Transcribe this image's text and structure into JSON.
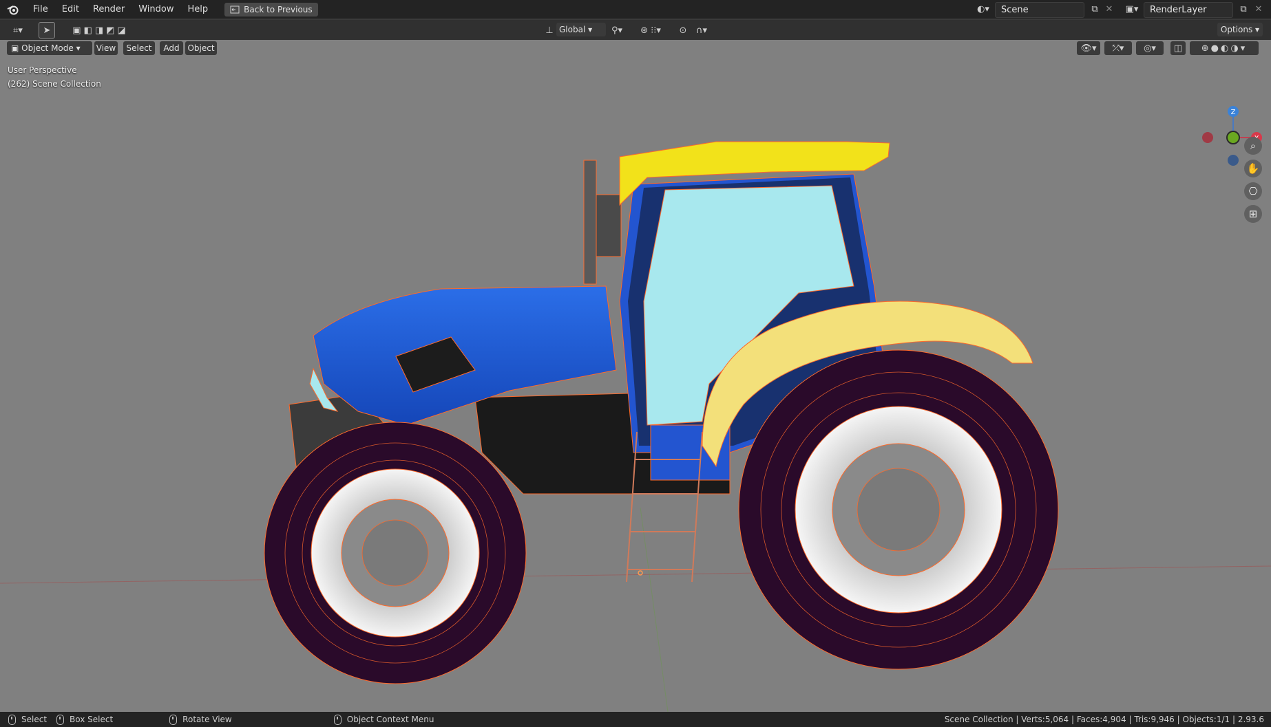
{
  "menu": [
    "File",
    "Edit",
    "Render",
    "Window",
    "Help"
  ],
  "back_button": "Back to Previous",
  "scene": "Scene",
  "render_layer": "RenderLayer",
  "toolbar": {
    "orientation": "Global",
    "options": "Options"
  },
  "viewport_header": {
    "mode": "Object Mode",
    "view": "View",
    "select": "Select",
    "add": "Add",
    "object": "Object"
  },
  "overlay": {
    "perspective": "User Perspective",
    "collection": "(262) Scene Collection"
  },
  "gizmo": {
    "z": "Z",
    "x": "X"
  },
  "status": {
    "select": "Select",
    "box_select": "Box Select",
    "rotate": "Rotate View",
    "context": "Object Context Menu",
    "stats": "Scene Collection | Verts:5,064 | Faces:4,904 | Tris:9,946 | Objects:1/1 | 2.93.6"
  },
  "colors": {
    "body_blue": "#1f5fd6",
    "roof_yellow": "#f2e21a",
    "fender_cream": "#f3e07a",
    "glass": "#a8e8ee",
    "tire": "#2a0a2a",
    "wire": "#ff6a2a"
  }
}
